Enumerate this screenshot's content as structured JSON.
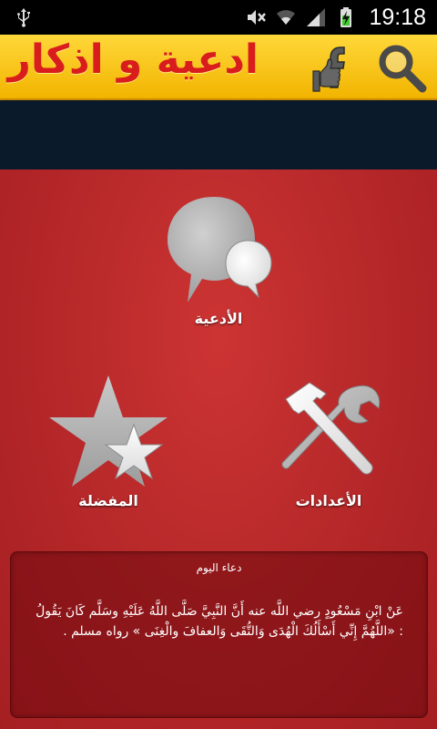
{
  "status_bar": {
    "time": "19:18",
    "icons": [
      "usb-icon",
      "mute-icon",
      "wifi-icon",
      "signal-icon",
      "battery-charging-icon"
    ]
  },
  "header": {
    "title": "ادعية و اذكار",
    "icons": [
      "facebook-like-icon",
      "search-icon"
    ],
    "background": "#f5c11a",
    "title_color": "#d91d1d"
  },
  "menu": {
    "duas_label": "الأدعية",
    "favorites_label": "المفضلة",
    "settings_label": "الأعدادات",
    "icons": [
      "chat-bubbles-icon",
      "stars-icon",
      "tools-icon"
    ]
  },
  "dua_of_day": {
    "title": "دعاء اليوم",
    "text": "عَنْ ابْنِ مَسْعُودٍ رضي اللَّه عنه أَنَّ النَّبِيَّ صَلَّى اللَّهُ عَلَيْهِ وسَلَّم كَانَ يَقُولُ : «اللَّهُمَّ إِنِّي أَسْأَلُكَ الْهُدَى وَالتُّقَى وَالعفافَ والْغِنَى » رواه مسلم ."
  },
  "colors": {
    "background_red": "#b8282b",
    "banner": "#0b1a2b",
    "icon_grey": "#b5b5b5"
  }
}
